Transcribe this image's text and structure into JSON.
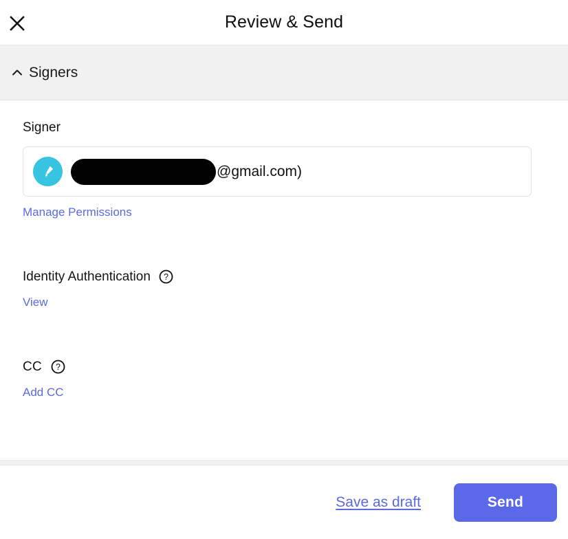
{
  "header": {
    "title": "Review & Send",
    "close_icon": "close-icon"
  },
  "section": {
    "title": "Signers",
    "chevron_icon": "chevron-up-icon",
    "expanded": true
  },
  "signer": {
    "label": "Signer",
    "avatar_icon": "pen-nib-icon",
    "avatar_color": "#37c4e0",
    "email_redacted": true,
    "email_suffix": "@gmail.com)",
    "manage_permissions_label": "Manage Permissions"
  },
  "identity_authentication": {
    "label": "Identity Authentication",
    "help_icon": "help-circle-icon",
    "view_label": "View"
  },
  "cc": {
    "label": "CC",
    "help_icon": "help-circle-icon",
    "add_label": "Add CC"
  },
  "footer": {
    "save_draft_label": "Save as draft",
    "send_label": "Send",
    "send_color": "#5b68e8",
    "link_color": "#5b6ae0"
  }
}
